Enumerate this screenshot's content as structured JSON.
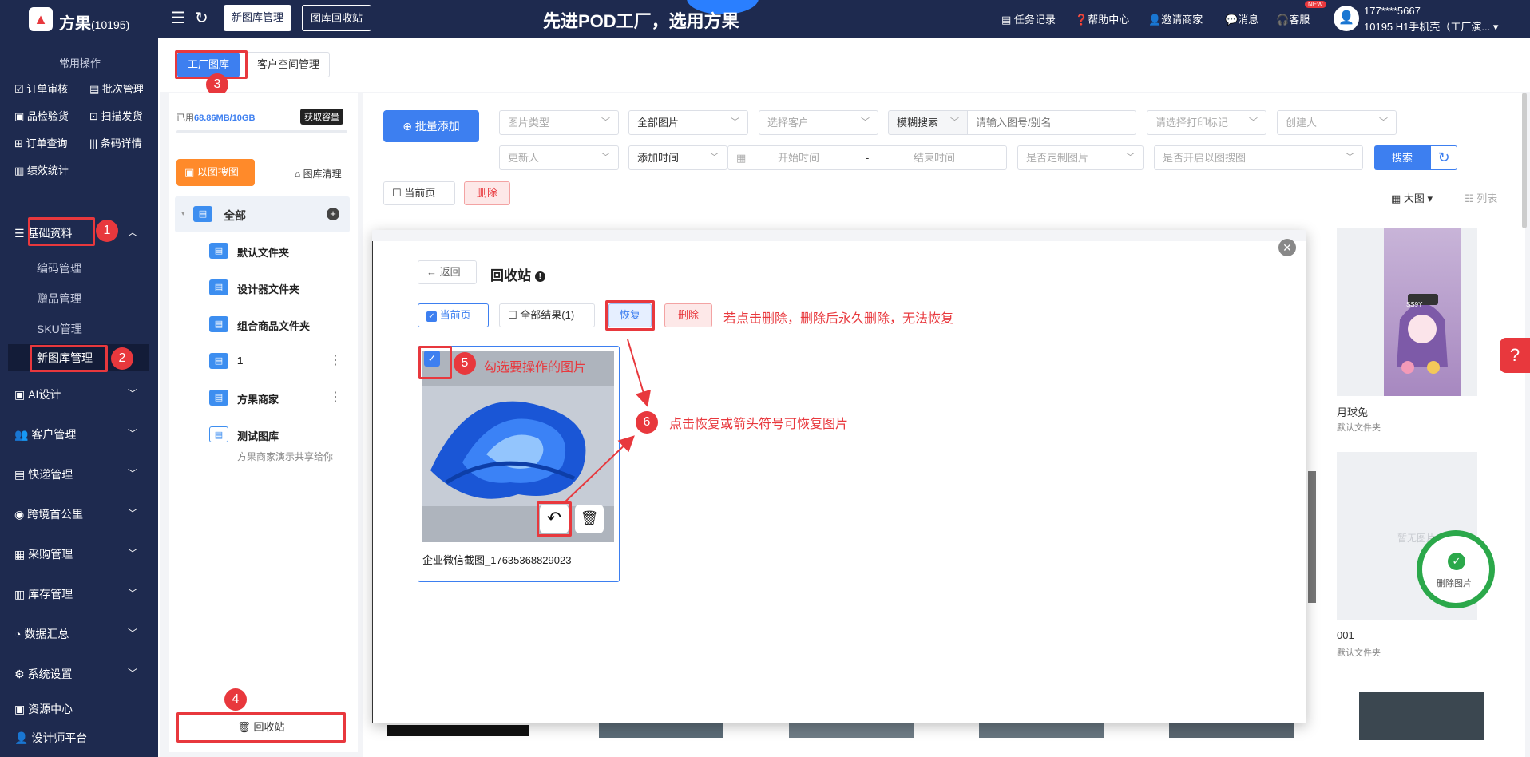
{
  "topbar": {
    "brand": "方果",
    "brand_count": "(10195)",
    "tab_new_gallery": "新图库管理",
    "tab_recycle": "图库回收站",
    "slogan": "先进POD工厂，选用方果",
    "links": [
      "任务记录",
      "帮助中心",
      "邀请商家",
      "消息",
      "客服"
    ],
    "new_badge": "NEW",
    "user_phone": "177****5667",
    "user_name": "10195 H1手机壳（工厂演...",
    "user_chevron": "▾"
  },
  "sidebar": {
    "header": "常用操作",
    "quick_actions": [
      "订单审核",
      "批次管理",
      "品检验货",
      "扫描发货",
      "订单查询",
      "条码详情",
      "绩效统计"
    ],
    "base": "基础资料",
    "sub_items": [
      "编码管理",
      "赠品管理",
      "SKU管理",
      "新图库管理"
    ],
    "menus": [
      "AI设计",
      "客户管理",
      "快递管理",
      "跨境首公里",
      "采购管理",
      "库存管理",
      "数据汇总",
      "系统设置"
    ],
    "extra": [
      "资源中心",
      "设计师平台"
    ]
  },
  "tabs": {
    "factory": "工厂图库",
    "customer": "客户空间管理"
  },
  "storage": {
    "used_label": "已用",
    "used_value": "68.86MB/10GB",
    "get_capacity": "获取容量"
  },
  "left": {
    "search_by_image": "以图搜图",
    "clean": "图库清理",
    "all": "全部",
    "folders": [
      "默认文件夹",
      "设计器文件夹",
      "组合商品文件夹",
      "1",
      "方果商家",
      "测试图库"
    ],
    "shared_note": "方果商家演示共享给你",
    "recycle": "回收站"
  },
  "filters": {
    "batch_add": "批量添加",
    "image_type": "图片类型",
    "all_images": "全部图片",
    "select_customer": "选择客户",
    "fuzzy": "模糊搜索",
    "search_placeholder": "请输入图号/别名",
    "print_mark": "请选择打印标记",
    "creator": "创建人",
    "updater": "更新人",
    "add_time": "添加时间",
    "start_time": "开始时间",
    "dash": "-",
    "end_time": "结束时间",
    "custom_image": "是否定制图片",
    "enable_search": "是否开启以图搜图",
    "search": "搜索",
    "current_page": "当前页",
    "delete": "删除",
    "view_large": "大图",
    "view_list": "列表"
  },
  "gallery": {
    "item1_name": "月球兔",
    "item1_folder": "默认文件夹",
    "no_image": "暂无图片",
    "deleted": "删除图片",
    "item2_name": "001",
    "item2_folder": "默认文件夹",
    "sticker": "SS9Y"
  },
  "modal": {
    "back": "返回",
    "title": "回收站",
    "current_page": "当前页",
    "all_results": "全部结果(1)",
    "restore": "恢复",
    "delete": "删除",
    "image_name": "企业微信截图_17635368829023"
  },
  "annotations": {
    "n1": "1",
    "n2": "2",
    "n3": "3",
    "n4": "4",
    "n5": "5",
    "n6": "6",
    "note_delete": "若点击删除，删除后永久删除，无法恢复",
    "note_select": "勾选要操作的图片",
    "note_restore": "点击恢复或箭头符号可恢复图片"
  },
  "colors": {
    "sidebar": "#1e2a4f",
    "primary": "#3d7ff0",
    "annotation": "#e8383d",
    "orange": "#ff8a2a",
    "success": "#2ba84a"
  }
}
